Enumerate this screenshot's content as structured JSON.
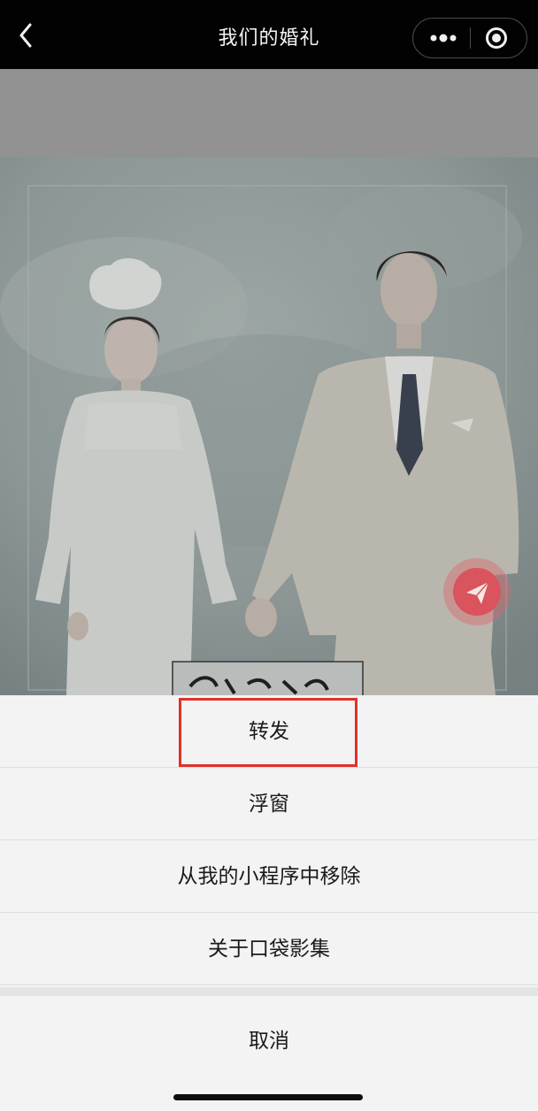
{
  "navbar": {
    "title": "我们的婚礼",
    "back_icon": "chevron-left-icon",
    "more_icon": "more-dots-icon",
    "close_icon": "target-circle-icon"
  },
  "photo": {
    "content": "wedding portrait of bride and groom holding hands",
    "fab_icon": "paper-plane-icon"
  },
  "action_sheet": {
    "items": [
      {
        "label": "转发"
      },
      {
        "label": "浮窗"
      },
      {
        "label": "从我的小程序中移除"
      },
      {
        "label": "关于口袋影集"
      }
    ],
    "cancel_label": "取消"
  },
  "colors": {
    "navbar_bg": "#020202",
    "overlay_band": "#929292",
    "sheet_bg": "#f3f3f3",
    "highlight": "#e0312b",
    "fab_red": "#d9545c"
  }
}
